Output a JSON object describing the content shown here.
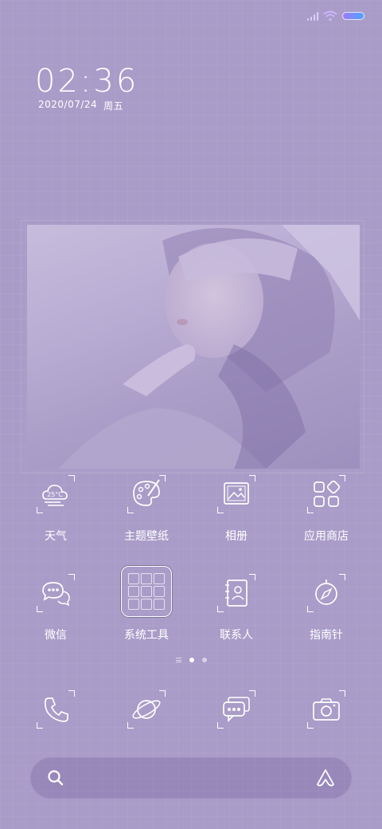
{
  "status_bar": {
    "signal_icon": "signal-icon",
    "wifi_icon": "wifi-icon",
    "battery_icon": "battery-icon",
    "colors": {
      "signal": "#d9d0ff",
      "battery_start": "#9b7bff",
      "battery_end": "#4fa4ff"
    }
  },
  "clock": {
    "time": "02:36",
    "date": "2020/07/24",
    "weekday": "周五"
  },
  "photo_widget": {
    "kind": "wallpaper-photo"
  },
  "apps": [
    {
      "label": "天气",
      "icon": "weather-icon",
      "badge_text": "25°C"
    },
    {
      "label": "主题壁纸",
      "icon": "palette-icon"
    },
    {
      "label": "相册",
      "icon": "gallery-icon"
    },
    {
      "label": "应用商店",
      "icon": "app-store-icon"
    },
    {
      "label": "微信",
      "icon": "wechat-icon"
    },
    {
      "label": "系统工具",
      "icon": "folder-icon"
    },
    {
      "label": "联系人",
      "icon": "contacts-icon"
    },
    {
      "label": "指南针",
      "icon": "compass-icon"
    }
  ],
  "page_indicator": {
    "pages": 3,
    "current": 2
  },
  "dock": [
    {
      "icon": "phone-icon"
    },
    {
      "icon": "browser-planet-icon"
    },
    {
      "icon": "messages-icon"
    },
    {
      "icon": "camera-icon"
    }
  ],
  "search_bar": {
    "search_icon": "search-icon",
    "assistant_icon": "assistant-icon"
  },
  "colors": {
    "background": "#a99cc8",
    "text": "#ffffff"
  }
}
